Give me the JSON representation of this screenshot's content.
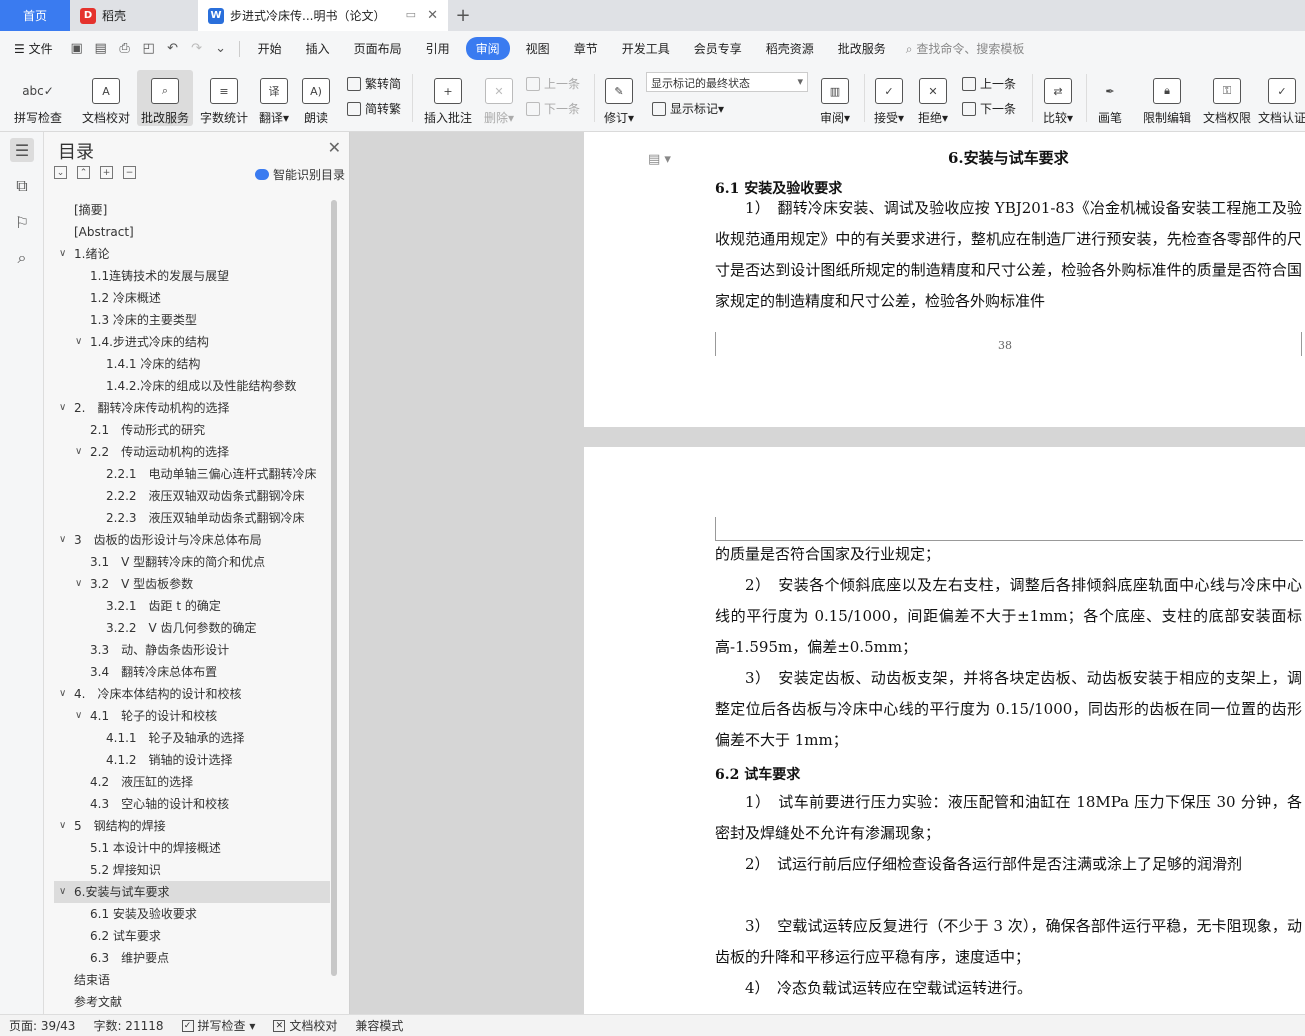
{
  "tabs": {
    "home": "首页",
    "wps": "稻壳",
    "doc": "步进式冷床传...明书（论文）"
  },
  "menu": {
    "file": "文件",
    "items": [
      "开始",
      "插入",
      "页面布局",
      "引用",
      "审阅",
      "视图",
      "章节",
      "开发工具",
      "会员专享",
      "稻壳资源",
      "批改服务"
    ],
    "active": "审阅",
    "search": "查找命令、搜索模板"
  },
  "ribbon": {
    "spell": "拼写检查",
    "doc_check": "文档校对",
    "correct_service": "批改服务",
    "word_count": "字数统计",
    "translate": "翻译",
    "read_aloud": "朗读",
    "trad": "繁转简",
    "simp": "简转繁",
    "insert_comment": "插入批注",
    "delete": "删除",
    "prev_comment": "上一条",
    "next_comment": "下一条",
    "revise": "修订",
    "markup_select": "显示标记的最终状态",
    "show_markup": "显示标记",
    "review": "审阅",
    "accept": "接受",
    "reject": "拒绝",
    "prev": "上一条",
    "next": "下一条",
    "compare": "比较",
    "ink": "画笔",
    "restrict": "限制编辑",
    "doc_perm": "文档权限",
    "doc_auth": "文档认证"
  },
  "toc": {
    "title": "目录",
    "smart": "智能识别目录",
    "items": [
      {
        "label": "[摘要]",
        "level": 0,
        "arrow": ""
      },
      {
        "label": "[Abstract]",
        "level": 0,
        "arrow": ""
      },
      {
        "label": "1.绪论",
        "level": 0,
        "arrow": "v"
      },
      {
        "label": "1.1连铸技术的发展与展望",
        "level": 1,
        "arrow": ""
      },
      {
        "label": "1.2 冷床概述",
        "level": 1,
        "arrow": ""
      },
      {
        "label": "1.3 冷床的主要类型",
        "level": 1,
        "arrow": ""
      },
      {
        "label": "1.4.步进式冷床的结构",
        "level": 1,
        "arrow": "v"
      },
      {
        "label": "1.4.1 冷床的结构",
        "level": 2,
        "arrow": ""
      },
      {
        "label": "1.4.2.冷床的组成以及性能结构参数",
        "level": 2,
        "arrow": ""
      },
      {
        "label": "2.　翻转冷床传动机构的选择",
        "level": 0,
        "arrow": "v"
      },
      {
        "label": "2.1　传动形式的研究",
        "level": 1,
        "arrow": ""
      },
      {
        "label": "2.2　传动运动机构的选择",
        "level": 1,
        "arrow": "v"
      },
      {
        "label": "2.2.1　电动单轴三偏心连杆式翻转冷床",
        "level": 2,
        "arrow": ""
      },
      {
        "label": "2.2.2　液压双轴双动齿条式翻钢冷床",
        "level": 2,
        "arrow": ""
      },
      {
        "label": "2.2.3　液压双轴单动齿条式翻钢冷床",
        "level": 2,
        "arrow": ""
      },
      {
        "label": "3　齿板的齿形设计与冷床总体布局",
        "level": 0,
        "arrow": "v"
      },
      {
        "label": "3.1　V 型翻转冷床的简介和优点",
        "level": 1,
        "arrow": ""
      },
      {
        "label": "3.2　V 型齿板参数",
        "level": 1,
        "arrow": "v"
      },
      {
        "label": "3.2.1　齿距 t 的确定",
        "level": 2,
        "arrow": ""
      },
      {
        "label": "3.2.2　V 齿几何参数的确定",
        "level": 2,
        "arrow": ""
      },
      {
        "label": "3.3　动、静齿条齿形设计",
        "level": 1,
        "arrow": ""
      },
      {
        "label": "3.4　翻转冷床总体布置",
        "level": 1,
        "arrow": ""
      },
      {
        "label": "4.　冷床本体结构的设计和校核",
        "level": 0,
        "arrow": "v"
      },
      {
        "label": "4.1　轮子的设计和校核",
        "level": 1,
        "arrow": "v"
      },
      {
        "label": "4.1.1　轮子及轴承的选择",
        "level": 2,
        "arrow": ""
      },
      {
        "label": "4.1.2　销轴的设计选择",
        "level": 2,
        "arrow": ""
      },
      {
        "label": "4.2　液压缸的选择",
        "level": 1,
        "arrow": ""
      },
      {
        "label": "4.3　空心轴的设计和校核",
        "level": 1,
        "arrow": ""
      },
      {
        "label": "5　钢结构的焊接",
        "level": 0,
        "arrow": "v"
      },
      {
        "label": "5.1 本设计中的焊接概述",
        "level": 1,
        "arrow": ""
      },
      {
        "label": "5.2 焊接知识",
        "level": 1,
        "arrow": ""
      },
      {
        "label": "6.安装与试车要求",
        "level": 0,
        "arrow": "v",
        "selected": true
      },
      {
        "label": "6.1 安装及验收要求",
        "level": 1,
        "arrow": ""
      },
      {
        "label": "6.2 试车要求",
        "level": 1,
        "arrow": ""
      },
      {
        "label": "6.3　维护要点",
        "level": 1,
        "arrow": ""
      },
      {
        "label": "结束语",
        "level": 0,
        "arrow": ""
      },
      {
        "label": "参考文献",
        "level": 0,
        "arrow": ""
      }
    ]
  },
  "document": {
    "chapter_title": "6.安装与试车要求",
    "sec61": "6.1 安装及验收要求",
    "p1": "1） 翻转冷床安装、调试及验收应按 YBJ201-83《冶金机械设备安装工程施工及验收规范通用规定》中的有关要求进行，整机应在制造厂进行预安装，先检查各零部件的尺寸是否达到设计图纸所规定的制造精度和尺寸公差，检验各外购标准件的质量是否符合国家规定的制造精度和尺寸公差，检验各外购标准件",
    "page_number": "38",
    "p1_cont": "的质量是否符合国家及行业规定；",
    "p2": "2） 安装各个倾斜底座以及左右支柱，调整后各排倾斜底座轨面中心线与冷床中心线的平行度为 0.15/1000，间距偏差不大于±1mm；各个底座、支柱的底部安装面标高-1.595m，偏差±0.5mm；",
    "p3": "3） 安装定齿板、动齿板支架，并将各块定齿板、动齿板安装于相应的支架上，调整定位后各齿板与冷床中心线的平行度为 0.15/1000，同齿形的齿板在同一位置的齿形偏差不大于 1mm；",
    "sec62": "6.2 试车要求",
    "q1": "1） 试车前要进行压力实验：液压配管和油缸在 18MPa 压力下保压 30 分钟，各密封及焊缝处不允许有渗漏现象；",
    "q2": "2） 试运行前后应仔细检查设备各运行部件是否注满或涂上了足够的润滑剂",
    "q3": "3） 空载试运转应反复进行（不少于 3 次），确保各部件运行平稳，无卡阻现象，动齿板的升降和平移运行应平稳有序，速度适中；",
    "q4": "4） 冷态负载试运转应在空载试运转进行。"
  },
  "status": {
    "page": "页面: 39/43",
    "words": "字数: 21118",
    "spell": "拼写检查",
    "check": "文档校对",
    "compat": "兼容模式"
  },
  "colors": {
    "accent": "#3a7bf0",
    "wps_red": "#e5322d",
    "doc_blue": "#2a6fdb"
  }
}
